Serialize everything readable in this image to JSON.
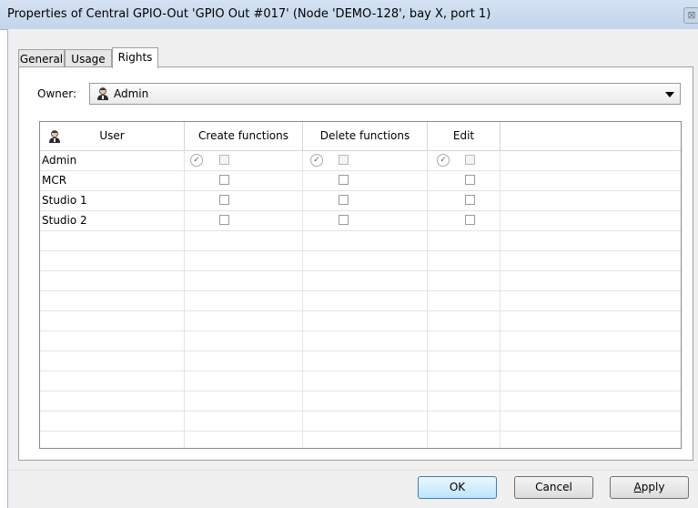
{
  "window": {
    "title": "Properties of Central GPIO-Out 'GPIO Out #017' (Node 'DEMO-128', bay X, port 1)",
    "close_glyph": "⊠"
  },
  "tabs": [
    {
      "label": "General",
      "active": false
    },
    {
      "label": "Usage",
      "active": false
    },
    {
      "label": "Rights",
      "active": true
    }
  ],
  "owner": {
    "label": "Owner:",
    "value": "Admin",
    "icon": "user-icon"
  },
  "grid": {
    "columns": [
      "User",
      "Create functions",
      "Delete functions",
      "Edit"
    ],
    "rows": [
      {
        "user": "Admin",
        "create": false,
        "delete": false,
        "edit": false,
        "has_default_marks": true
      },
      {
        "user": "MCR",
        "create": false,
        "delete": false,
        "edit": false,
        "has_default_marks": false
      },
      {
        "user": "Studio 1",
        "create": false,
        "delete": false,
        "edit": false,
        "has_default_marks": false
      },
      {
        "user": "Studio 2",
        "create": false,
        "delete": false,
        "edit": false,
        "has_default_marks": false
      }
    ],
    "default_mark_glyph": "✓"
  },
  "buttons": {
    "ok": "OK",
    "cancel": "Cancel",
    "apply_first": "A",
    "apply_rest": "pply"
  },
  "colors": {
    "titlebar": "#c8d9ee",
    "default_button": "#bee6fd"
  }
}
